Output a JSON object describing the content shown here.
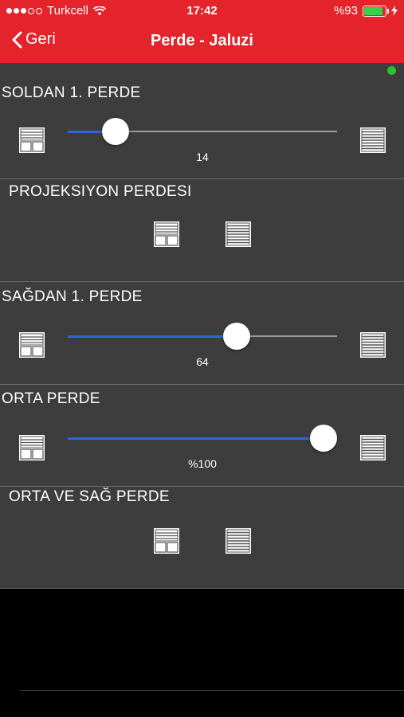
{
  "status": {
    "carrier": "Turkcell",
    "time": "17:42",
    "battery": "%93"
  },
  "nav": {
    "back_label": "Geri",
    "title": "Perde - Jaluzi"
  },
  "sections": [
    {
      "label": "SOLDAN 1. PERDE",
      "value_label": "14",
      "level": 0.14
    },
    {
      "label": "PROJEKSIYON PERDESI"
    },
    {
      "label": "SAĞDAN 1. PERDE",
      "value_label": "64",
      "level": 0.64
    },
    {
      "label": "ORTA PERDE",
      "value_label": "%100",
      "level": 1.0
    },
    {
      "label": "ORTA VE SAĞ PERDE"
    }
  ],
  "colors": {
    "header": "#e5232b",
    "panel": "#3d3d3d",
    "slider_fill": "#2b67d9",
    "connection": "#2fbf2f"
  }
}
